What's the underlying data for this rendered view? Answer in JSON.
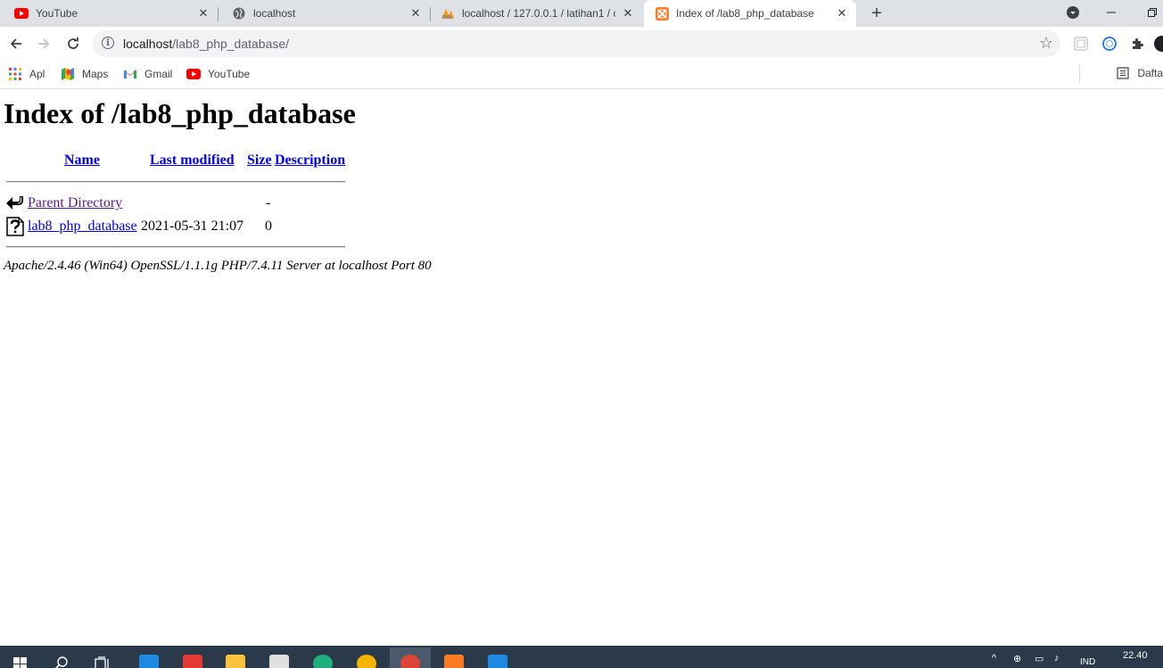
{
  "browser": {
    "tabs": [
      {
        "title": "YouTube",
        "icon": "youtube-icon"
      },
      {
        "title": "localhost",
        "icon": "globe-icon"
      },
      {
        "title": "localhost / 127.0.0.1 / latihan1 / c",
        "icon": "phpmyadmin-icon"
      },
      {
        "title": "Index of /lab8_php_database",
        "icon": "xampp-icon",
        "active": true
      }
    ],
    "url_host": "localhost",
    "url_path": "/lab8_php_database/",
    "bookmarks": [
      {
        "label": "Apl",
        "icon": "apps-grid-icon"
      },
      {
        "label": "Maps",
        "icon": "maps-icon"
      },
      {
        "label": "Gmail",
        "icon": "gmail-icon"
      },
      {
        "label": "YouTube",
        "icon": "youtube-icon"
      }
    ],
    "reading_list_label": "Daftar"
  },
  "page": {
    "heading": "Index of /lab8_php_database",
    "columns": {
      "name": "Name",
      "modified": "Last modified",
      "size": "Size",
      "description": "Description"
    },
    "rows": [
      {
        "name": "Parent Directory",
        "modified": "",
        "size": "-",
        "description": "",
        "icon": "back-arrow-icon"
      },
      {
        "name": "lab8_php_database",
        "modified": "2021-05-31 21:07",
        "size": "0",
        "description": "",
        "icon": "unknown-file-icon"
      }
    ],
    "server_signature": "Apache/2.4.46 (Win64) OpenSSL/1.1.1g PHP/7.4.11 Server at localhost Port 80"
  },
  "taskbar": {
    "apps": [
      "windows-start-icon",
      "search-icon",
      "task-view-icon",
      "mail-icon",
      "gift-icon",
      "file-explorer-icon",
      "store-icon",
      "edge-icon",
      "app-icon",
      "chrome-icon",
      "xampp-icon",
      "vscode-icon"
    ],
    "language": "IND",
    "time": "22.40"
  },
  "colors": {
    "tabstrip": "#dee1e6",
    "link": "#0000ee",
    "visited": "#551a8b",
    "taskbar": "#2b3a4a"
  }
}
